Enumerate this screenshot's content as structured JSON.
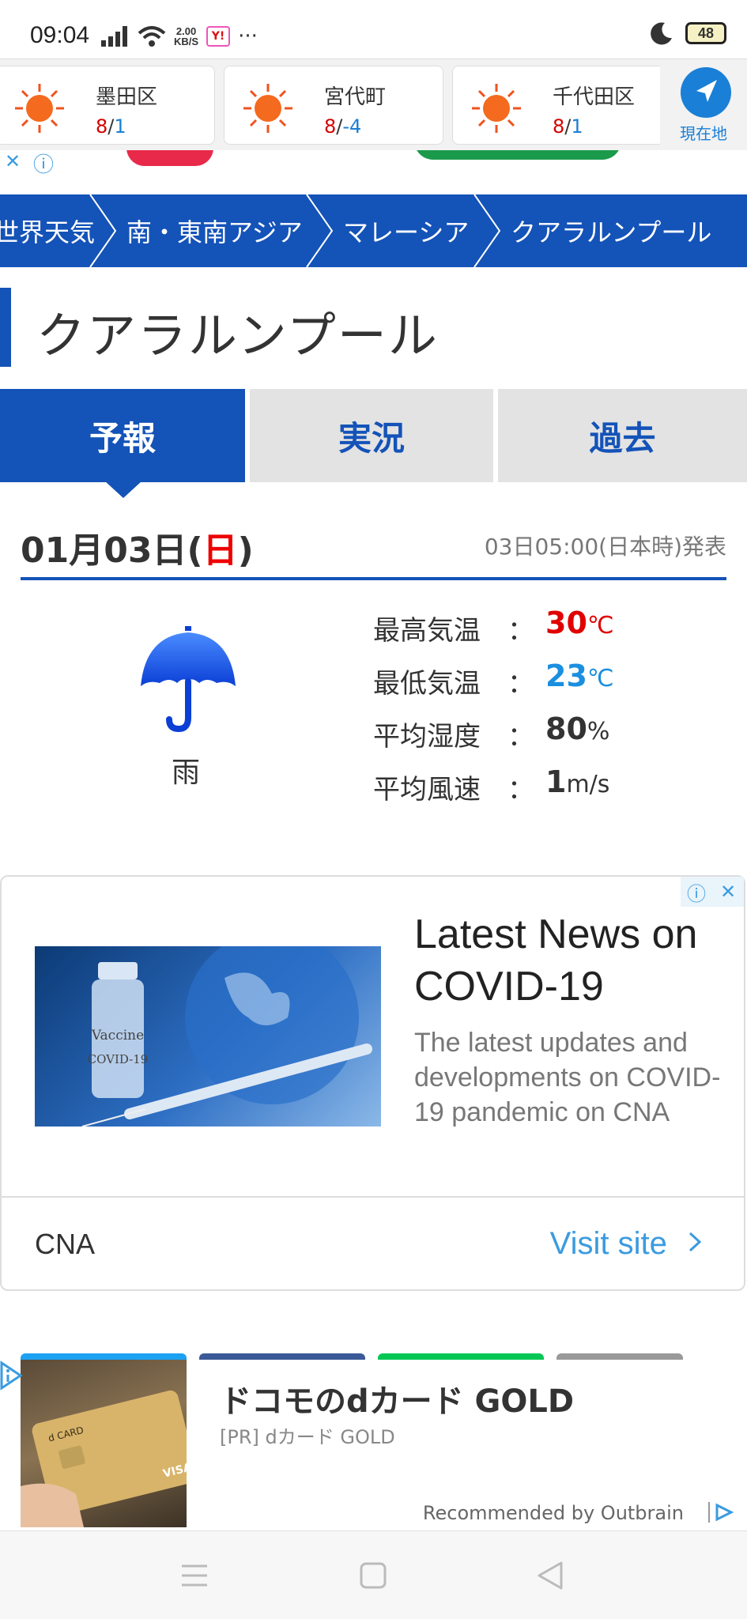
{
  "status_bar": {
    "time": "09:04",
    "net_speed_value": "2.00",
    "net_speed_unit": "KB/S",
    "yahoo_label": "Y!",
    "more": "···",
    "battery": "48"
  },
  "city_strip": {
    "cities": [
      {
        "name": "墨田区",
        "high": "8",
        "low": "1"
      },
      {
        "name": "宮代町",
        "high": "8",
        "low": "-4"
      },
      {
        "name": "千代田区",
        "high": "8",
        "low": "1"
      }
    ],
    "separator": "/",
    "location_label": "現在地"
  },
  "breadcrumb": {
    "items": [
      "世界天気",
      "南・東南アジア",
      "マレーシア",
      "クアラルンプール"
    ]
  },
  "page_title": "クアラルンプール",
  "tabs": [
    {
      "label": "予報",
      "active": true
    },
    {
      "label": "実況",
      "active": false
    },
    {
      "label": "過去",
      "active": false
    }
  ],
  "forecast": {
    "date_prefix": "01月03日(",
    "weekday": "日",
    "date_suffix": ")",
    "issued": "03日05:00(日本時)発表",
    "weather_icon": "umbrella-icon",
    "weather_label": "雨",
    "stats": [
      {
        "label": "最高気温",
        "colon": "：",
        "value": "30",
        "unit": "℃",
        "color": "#e00000"
      },
      {
        "label": "最低気温",
        "colon": "：",
        "value": "23",
        "unit": "℃",
        "color": "#1a8fe0"
      },
      {
        "label": "平均湿度",
        "colon": "：",
        "value": "80",
        "unit": "%",
        "color": "#333333"
      },
      {
        "label": "平均風速",
        "colon": "：",
        "value": "1",
        "unit": "m/s",
        "color": "#333333"
      }
    ]
  },
  "ad": {
    "title": "Latest News on COVID-19",
    "description": "The latest updates and developments on COVID-19 pandemic on CNA",
    "brand": "CNA",
    "cta": "Visit site",
    "vial_text_1": "Vaccine",
    "vial_text_2": "COVID-19",
    "info_icon": "ⓘ",
    "close_icon": "✕"
  },
  "recommendation": {
    "title": "ドコモのdカード GOLD",
    "subtitle": "[PR] dカード GOLD",
    "credit": "Recommended by Outbrain",
    "card_text_1": "d CARD",
    "card_text_2": "VISA"
  },
  "colors": {
    "brand_blue": "#1453b8",
    "link_blue": "#3a9be0",
    "high_red": "#d40000",
    "low_blue": "#1a7fd6"
  }
}
